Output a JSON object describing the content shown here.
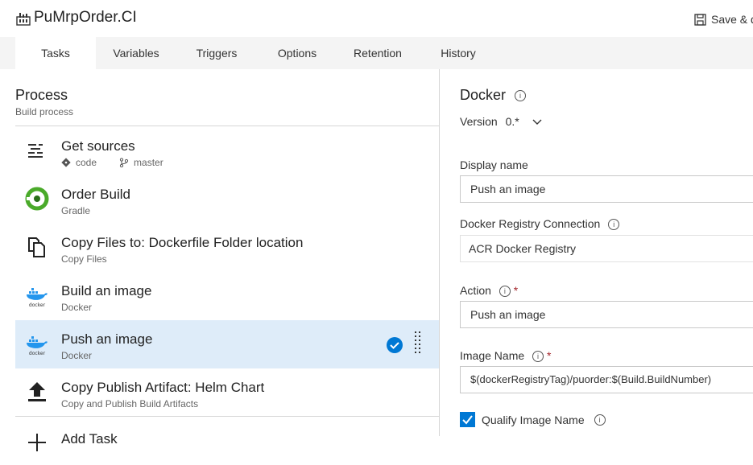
{
  "header": {
    "title": "PuMrpOrder.CI",
    "save_label": "Save & q"
  },
  "tabs": [
    {
      "label": "Tasks",
      "active": true
    },
    {
      "label": "Variables"
    },
    {
      "label": "Triggers"
    },
    {
      "label": "Options"
    },
    {
      "label": "Retention"
    },
    {
      "label": "History"
    }
  ],
  "process": {
    "title": "Process",
    "subtitle": "Build process"
  },
  "tasks": [
    {
      "title": "Get sources",
      "icon": "get-sources-icon",
      "repo": "code",
      "branch": "master"
    },
    {
      "title": "Order Build",
      "subtitle": "Gradle",
      "icon": "gradle-icon"
    },
    {
      "title": "Copy Files to: Dockerfile Folder location",
      "subtitle": "Copy Files",
      "icon": "copy-files-icon"
    },
    {
      "title": "Build an image",
      "subtitle": "Docker",
      "icon": "docker-icon"
    },
    {
      "title": "Push an image",
      "subtitle": "Docker",
      "icon": "docker-icon",
      "selected": true
    },
    {
      "title": "Copy Publish Artifact: Helm Chart",
      "subtitle": "Copy and Publish Build Artifacts",
      "icon": "upload-icon"
    },
    {
      "title": "Add Task",
      "icon": "add-icon"
    }
  ],
  "details": {
    "title": "Docker",
    "version_label": "Version",
    "version_value": "0.*",
    "display_name_label": "Display name",
    "display_name_value": "Push an image",
    "registry_label": "Docker Registry Connection",
    "registry_value": "ACR Docker Registry",
    "action_label": "Action",
    "action_value": "Push an image",
    "image_name_label": "Image Name",
    "image_name_value": "$(dockerRegistryTag)/puorder:$(Build.BuildNumber)",
    "qualify_label": "Qualify Image Name",
    "qualify_checked": true
  },
  "colors": {
    "accent": "#0078d4",
    "selected_bg": "#deecf9",
    "tabbar_bg": "#f4f4f4",
    "gradle_green": "#4aaa2a"
  }
}
